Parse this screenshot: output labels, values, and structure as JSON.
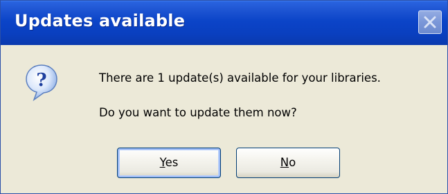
{
  "dialog": {
    "title": "Updates available",
    "message": "There are 1 update(s) available for your libraries.",
    "question": "Do you want to update them now?",
    "icon": "question-icon",
    "buttons": {
      "yes": {
        "first": "Y",
        "rest": "es"
      },
      "no": {
        "first": "N",
        "rest": "o"
      }
    },
    "colors": {
      "titlebar": "#0a44c8",
      "dialog_bg": "#ece9d8",
      "button_border": "#003c74"
    }
  }
}
